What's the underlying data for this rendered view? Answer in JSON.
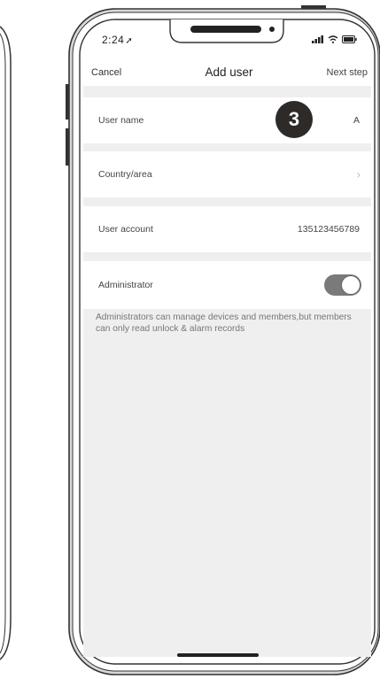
{
  "status_bar": {
    "time": "2:24",
    "location_glyph": "➚",
    "icons": [
      "signal-icon",
      "wifi-icon",
      "battery-icon"
    ]
  },
  "nav": {
    "cancel_label": "Cancel",
    "title": "Add user",
    "next_label": "Next step"
  },
  "form": {
    "rows": [
      {
        "label": "User name",
        "value": "A"
      },
      {
        "label": "Country/area",
        "value": ""
      },
      {
        "label": "User account",
        "value": "135123456789"
      },
      {
        "label": "Administrator",
        "toggle_on": true
      }
    ],
    "chevron_glyph": "›"
  },
  "step_badge": "3",
  "note": "Administrators can manage devices and members,but members can only read unlock & alarm records",
  "colors": {
    "list_background": "#efefef",
    "badge": "#2e2a28",
    "toggle_on": "#7a7a7a"
  }
}
